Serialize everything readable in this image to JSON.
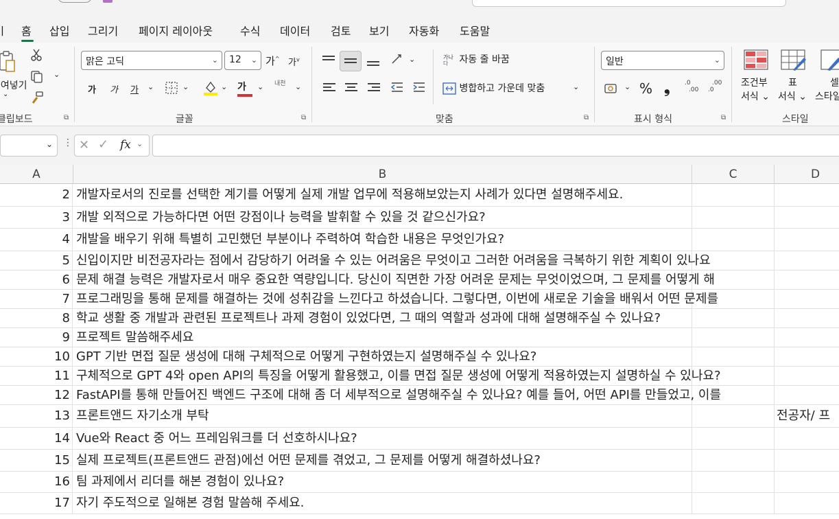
{
  "tabs": [
    {
      "label": "홈",
      "active": true
    },
    {
      "label": "삽입"
    },
    {
      "label": "그리기"
    },
    {
      "label": "페이지 레이아웃"
    },
    {
      "label": "수식"
    },
    {
      "label": "데이터"
    },
    {
      "label": "검토"
    },
    {
      "label": "보기"
    },
    {
      "label": "자동화"
    },
    {
      "label": "도움말"
    }
  ],
  "ribbon": {
    "clipboard": {
      "paste_label": "붙여넣기",
      "group_label": "클립보드"
    },
    "font": {
      "font_name": "맑은 고딕",
      "font_size": "12",
      "group_label": "글꼴",
      "bold": "가",
      "italic": "가",
      "underline": "가",
      "grow": "가",
      "shrink": "가",
      "font_color_glyph": "가",
      "phonetic": "내천"
    },
    "alignment": {
      "wrap_text": "자동 줄 바꿈",
      "merge_center": "병합하고 가운데 맞춤",
      "group_label": "맞춤"
    },
    "number": {
      "format": "일반",
      "percent": "%",
      "comma": "❟",
      "inc_decimal_top": ".0",
      "inc_decimal_bottom": ".00",
      "dec_decimal_top": ".00",
      "dec_decimal_bottom": ".0",
      "group_label": "표시 형식"
    },
    "styles": {
      "conditional_top": "조건부",
      "conditional_bottom": "서식",
      "table_top": "표",
      "table_bottom": "서식",
      "cell_top": "셀",
      "cell_bottom": "스타일",
      "group_label": "스타일"
    }
  },
  "formula_bar": {
    "name_box": "",
    "formula": "",
    "fx": "fx"
  },
  "columns": [
    "A",
    "B",
    "C",
    "D"
  ],
  "rows": [
    {
      "num": "2",
      "b": "개발자로서의 진로를 선택한 계기를 어떻게 실제 개발 업무에 적용해보았는지 사례가 있다면 설명해주세요.",
      "d": ""
    },
    {
      "num": "3",
      "b": "개발 외적으로 가능하다면 어떤 강점이나 능력을 발휘할 수 있을 것 같으신가요?",
      "d": ""
    },
    {
      "num": "4",
      "b": "개발을 배우기 위해 특별히 고민했던 부분이나 주력하여 학습한 내용은 무엇인가요?",
      "d": ""
    },
    {
      "num": "5",
      "b": "신입이지만 비전공자라는 점에서 감당하기 어려울 수 있는 어려움은 무엇이고 그러한 어려움을 극복하기 위한 계획이 있나요",
      "d": ""
    },
    {
      "num": "6",
      "b": "문제 해결 능력은 개발자로서 매우 중요한 역량입니다. 당신이 직면한 가장 어려운 문제는 무엇이었으며, 그 문제를 어떻게 해",
      "d": ""
    },
    {
      "num": "7",
      "b": "프로그래밍을 통해 문제를 해결하는 것에 성취감을 느낀다고 하셨습니다. 그렇다면, 이번에 새로운 기술을 배워서 어떤 문제를",
      "d": ""
    },
    {
      "num": "8",
      "b": "학교 생활 중 개발과 관련된 프로젝트나 과제 경험이 있었다면, 그 때의 역할과 성과에 대해 설명해주실 수 있나요?",
      "d": ""
    },
    {
      "num": "9",
      "b": "프로젝트 말씀해주세요",
      "d": ""
    },
    {
      "num": "10",
      "b": "GPT 기반 면접 질문 생성에 대해 구체적으로 어떻게 구현하였는지 설명해주실 수 있나요?",
      "d": ""
    },
    {
      "num": "11",
      "b": "구체적으로 GPT 4와 open API의 특징을 어떻게 활용했고, 이를 면접 질문 생성에 어떻게 적용하였는지 설명하실 수 있나요?",
      "d": ""
    },
    {
      "num": "12",
      "b": "FastAPI를 통해 만들어진 백엔드 구조에 대해 좀 더 세부적으로 설명해주실 수 있나요? 예를 들어, 어떤 API를 만들었고, 이를",
      "d": ""
    },
    {
      "num": "13",
      "b": "프론트앤드 자기소개 부탁",
      "d": "전공자/ 프"
    },
    {
      "num": "14",
      "b": "Vue와 React 중 어느 프레임워크를 더 선호하시나요?",
      "d": ""
    },
    {
      "num": "15",
      "b": "실제 프로젝트(프론트앤드 관점)에선 어떤 문제를 겪었고, 그 문제를 어떻게 해결하셨나요?",
      "d": ""
    },
    {
      "num": "16",
      "b": "팀 과제에서 리더를 해본 경험이 있나요?",
      "d": ""
    },
    {
      "num": "17",
      "b": "자기 주도적으로 일해본 경험 말씀해 주세요.",
      "d": ""
    }
  ],
  "colors": {
    "accent": "#217346",
    "ribbon_bg": "#f8f8f8",
    "font_color_bar": "#d13438",
    "highlight_bar": "#ffeb00"
  }
}
